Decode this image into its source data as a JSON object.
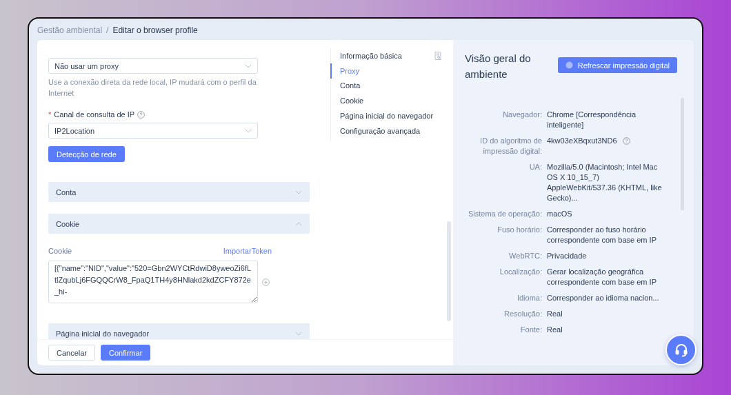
{
  "breadcrumb": {
    "separator": "/",
    "items": [
      {
        "label": "Gestão ambiental",
        "current": false
      },
      {
        "label": "Editar o browser profile",
        "current": true
      }
    ]
  },
  "proxy": {
    "proxy_type_value": "Não usar um proxy",
    "hint": "Use a conexão direta da rede local, IP mudará com o perfil da Internet",
    "ip_channel": {
      "required_mark": "*",
      "label": "Canal de consulta de IP",
      "value": "IP2Location"
    },
    "detect_button": "Detecção de rede"
  },
  "sections": [
    {
      "title": "Conta",
      "expanded": false
    },
    {
      "title": "Cookie",
      "expanded": true,
      "cookie": {
        "label": "Cookie",
        "import_link": "ImportarToken",
        "value": "[{\"name\":\"NID\",\"value\":\"520=Gbn2WYCtRdwiD8yweoZi6fLtlZqubLj6FGQQCrW8_FpaQ1TH4y8HNlakd2kdZCFY872e_hi-"
      }
    },
    {
      "title": "Página inicial do navegador",
      "expanded": false
    }
  ],
  "footer_buttons": [
    {
      "label": "Cancelar",
      "kind": "default"
    },
    {
      "label": "Confirmar",
      "kind": "primary"
    }
  ],
  "anchor_nav": [
    {
      "label": "Informação básica",
      "selected": false
    },
    {
      "label": "Proxy",
      "selected": true
    },
    {
      "label": "Conta",
      "selected": false
    },
    {
      "label": "Cookie",
      "selected": false
    },
    {
      "label": "Página inicial do navegador",
      "selected": false
    },
    {
      "label": "Configuração avançada",
      "selected": false
    }
  ],
  "overview": {
    "title": "Visão geral do ambiente",
    "refresh_button": "Refrescar impressão digital",
    "rows": [
      {
        "label": "Navegador:",
        "value": "Chrome [Correspondência inteligente]",
        "help": false
      },
      {
        "label": "ID do algoritmo de impressão digital:",
        "value": "4kw03eXBqxut3ND6",
        "help": true
      },
      {
        "label": "UA:",
        "value": "Mozilla/5.0 (Macintosh; Intel Mac OS X 10_15_7) AppleWebKit/537.36 (KHTML, like Gecko)...",
        "help": false
      },
      {
        "label": "Sistema de operação:",
        "value": "macOS",
        "help": false
      },
      {
        "label": "Fuso horário:",
        "value": "Corresponder ao fuso horário correspondente com base em IP",
        "help": false
      },
      {
        "label": "WebRTC:",
        "value": "Privacidade",
        "help": false
      },
      {
        "label": "Localização:",
        "value": "Gerar localização geográfica correspondente com base em IP",
        "help": false
      },
      {
        "label": "Idioma:",
        "value": "Corresponder ao idioma nacion...",
        "help": false
      },
      {
        "label": "Resolução:",
        "value": "Real",
        "help": false
      },
      {
        "label": "Fonte:",
        "value": "Real",
        "help": false
      }
    ]
  }
}
